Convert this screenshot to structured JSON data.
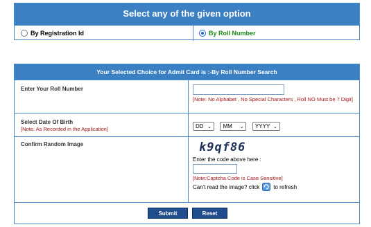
{
  "option_box": {
    "title": "Select any of the given option",
    "options": [
      {
        "label": "By Registration Id",
        "selected": false
      },
      {
        "label": "By Roll Number",
        "selected": true
      }
    ]
  },
  "form": {
    "header": "Your Selected Choice for Admit Card is :-By Roll Number Search",
    "roll": {
      "label": "Enter Your Roll Number",
      "value": "",
      "note": "[Note: No Alphabet , No Special Characters , Roll NO Must be 7 Digit]"
    },
    "dob": {
      "label": "Select Date Of Birth",
      "note": "[Note: As Recorded in the Application]",
      "day": "DD",
      "month": "MM",
      "year": "YYYY"
    },
    "captcha": {
      "label": "Confirm Random Image",
      "image_text": "k9qf86",
      "prompt": "Enter the code above here :",
      "value": "",
      "note": "[Note:Captcha Code is Case Sensitive]",
      "refresh_text": "Can't read the image? click",
      "refresh_suffix": "to refresh"
    },
    "buttons": {
      "submit": "Submit",
      "reset": "Reset"
    }
  },
  "colors": {
    "header_bg": "#3c80c4",
    "border": "#4a89c3",
    "selected_option": "#1a8a1a",
    "note": "#a4161a",
    "button_bg": "#1f4c8c"
  }
}
